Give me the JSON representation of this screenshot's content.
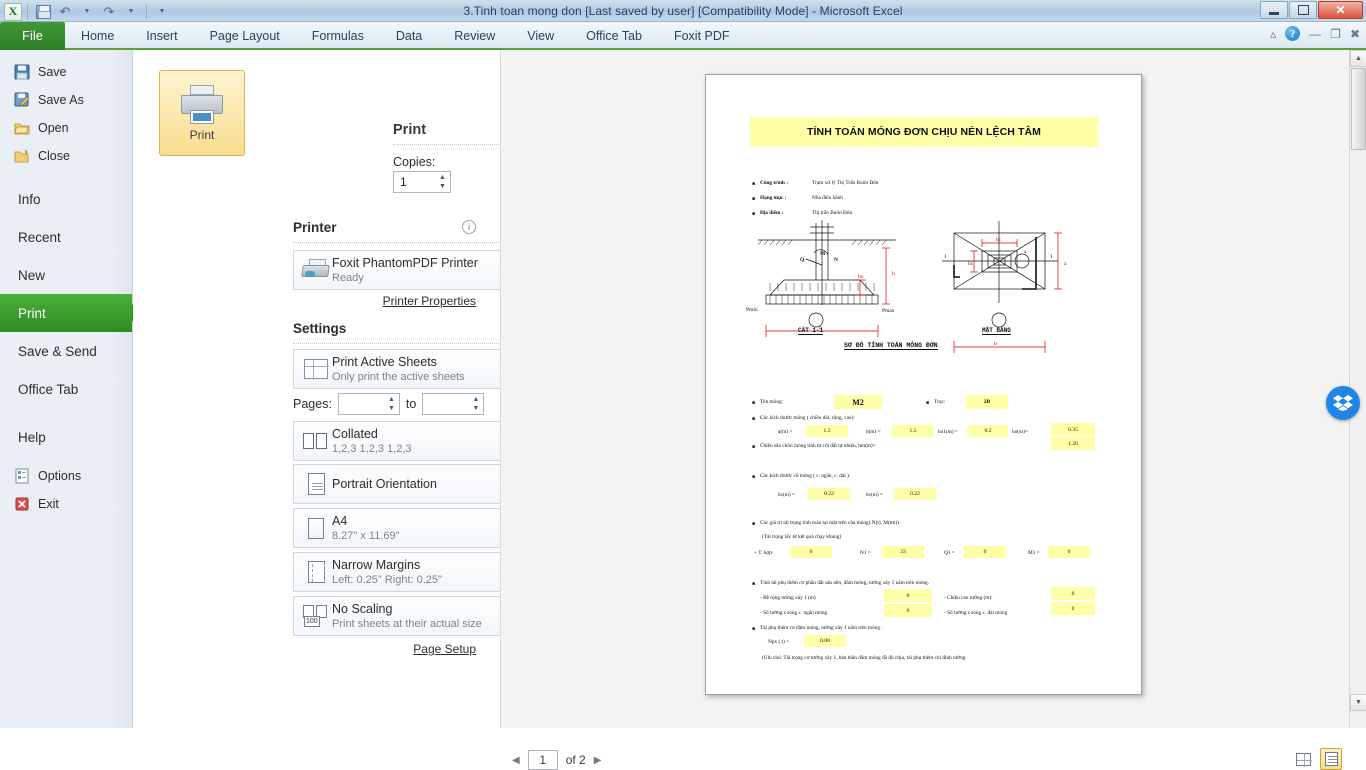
{
  "window": {
    "title": "3.Tinh toan mong don [Last saved by user]  [Compatibility Mode]  -  Microsoft Excel",
    "quick_access": [
      {
        "name": "excel-logo",
        "label": "X"
      },
      {
        "name": "save",
        "label": ""
      },
      {
        "name": "undo",
        "label": "↶"
      },
      {
        "name": "redo",
        "label": "↷"
      },
      {
        "name": "customize-qat",
        "label": "▾"
      }
    ],
    "controls": {
      "minimize": "–",
      "restore": "❐",
      "close": "✕"
    },
    "ribbon_right": {
      "collapse": "⌃",
      "help": "?",
      "win_min": "–",
      "win_restore": "❐",
      "win_close": "✕"
    }
  },
  "ribbon": {
    "tabs": [
      {
        "label": "File",
        "active": true
      },
      {
        "label": "Home",
        "active": false
      },
      {
        "label": "Insert",
        "active": false
      },
      {
        "label": "Page Layout",
        "active": false
      },
      {
        "label": "Formulas",
        "active": false
      },
      {
        "label": "Data",
        "active": false
      },
      {
        "label": "Review",
        "active": false
      },
      {
        "label": "View",
        "active": false
      },
      {
        "label": "Office Tab",
        "active": false
      },
      {
        "label": "Foxit PDF",
        "active": false
      }
    ]
  },
  "sidebar": {
    "items": [
      {
        "label": "Save",
        "icon": "floppy-disk-icon",
        "type": "icon",
        "selected": false
      },
      {
        "label": "Save As",
        "icon": "save-as-icon",
        "type": "icon",
        "selected": false
      },
      {
        "label": "Open",
        "icon": "open-folder-icon",
        "type": "icon",
        "selected": false
      },
      {
        "label": "Close",
        "icon": "close-folder-icon",
        "type": "icon",
        "selected": false
      },
      {
        "label": "Info",
        "icon": "",
        "type": "big",
        "selected": false
      },
      {
        "label": "Recent",
        "icon": "",
        "type": "big",
        "selected": false
      },
      {
        "label": "New",
        "icon": "",
        "type": "big",
        "selected": false
      },
      {
        "label": "Print",
        "icon": "",
        "type": "big",
        "selected": true
      },
      {
        "label": "Save & Send",
        "icon": "",
        "type": "big",
        "selected": false
      },
      {
        "label": "Office Tab",
        "icon": "",
        "type": "big",
        "selected": false
      },
      {
        "label": "Help",
        "icon": "",
        "type": "big",
        "selected": false
      },
      {
        "label": "Options",
        "icon": "options-icon",
        "type": "icon",
        "selected": false
      },
      {
        "label": "Exit",
        "icon": "exit-icon",
        "type": "icon",
        "selected": false
      }
    ]
  },
  "print": {
    "button_label": "Print",
    "heading": "Print",
    "copies_label": "Copies:",
    "copies_value": "1",
    "printer_section": "Printer",
    "printer_name": "Foxit PhantomPDF Printer",
    "printer_status": "Ready",
    "printer_properties_link": "Printer Properties",
    "settings_section": "Settings",
    "settings": [
      {
        "name": "print-what",
        "title": "Print Active Sheets",
        "subtitle": "Only print the active sheets",
        "icon": "sheets-icon"
      },
      {
        "name": "collation",
        "title": "Collated",
        "subtitle": "1,2,3   1,2,3   1,2,3",
        "icon": "collate-icon"
      },
      {
        "name": "orientation",
        "title": "Portrait Orientation",
        "subtitle": "",
        "icon": "portrait-icon"
      },
      {
        "name": "paper-size",
        "title": "A4",
        "subtitle": "8.27\" x 11.69\"",
        "icon": "paper-icon"
      },
      {
        "name": "margins",
        "title": "Narrow Margins",
        "subtitle": "Left:  0.25\"    Right:  0.25\"",
        "icon": "margins-icon"
      },
      {
        "name": "scaling",
        "title": "No Scaling",
        "subtitle": "Print sheets at their actual size",
        "icon": "scaling-icon"
      }
    ],
    "pages_label": "Pages:",
    "pages_from": "",
    "pages_to_label": "to",
    "pages_to": "",
    "page_setup_link": "Page Setup"
  },
  "preview": {
    "current_page": "1",
    "page_count_label": "of 2",
    "prev_arrow": "◀",
    "next_arrow": "▶",
    "show_margins_tooltip": "Show Margins",
    "zoom_to_page_tooltip": "Zoom to Page"
  },
  "document": {
    "title": "TÍNH TOÁN MÓNG ĐƠN CHỊU NÉN LỆCH TÂM",
    "header_rows": [
      {
        "label": "Công trình :",
        "value": "Trạm xử lý Thị Trấn Buôn Đôn"
      },
      {
        "label": "Hạng mục :",
        "value": "Nhà điều hành"
      },
      {
        "label": "Địa điểm :",
        "value": "Thị trấn Buôn Đôn"
      }
    ],
    "diagram": {
      "section_caption": "CẮT 1-1",
      "plan_caption": "MẬT BẰNG",
      "main_caption": "SƠ ĐỒ TÍNH TOÁN MÓNG ĐƠN",
      "labels": [
        "M",
        "N",
        "Q",
        "Pmin",
        "Pmax",
        "b",
        "a",
        "h",
        "ho",
        "1",
        "1"
      ]
    },
    "fields": {
      "name_label": "Tên móng:",
      "name_value": "M2",
      "axis_label": "Trục:",
      "axis_value": "2B",
      "dims_note": "Các kích thước móng ( chiều dài, rộng, cao):",
      "a_label": "a(m) =",
      "a_value": "1.5",
      "b_label": "b(m) =",
      "b_value": "1.5",
      "ho1_label": "ho1(m) =",
      "ho1_value": "0.2",
      "ho_label": "ho(m)=",
      "ho_value": "0.35",
      "depth_label": "Chiều sâu chôn móng tính từ cốt đất tự nhiên, hm(m)=",
      "depth_value": "1.20",
      "col_note": "Các kích thước cổ móng ( c. ngắn, c. dài ):",
      "hc_label": "hc(m) =",
      "hc_value": "0.22",
      "bc_label": "bc(m) =",
      "bc_value": "0.22",
      "load_note": "Các giá trị tải trọng tính toán tại mặt trên của móng( N(t), M(tm))",
      "load_subnote": "(Tải trọng lấy từ kết quả chạy khung)",
      "case_label": "+ T. hợp:",
      "case_value": "6",
      "n1_label": "N1 =",
      "n1_value": "33",
      "q1_label": "Q1 =",
      "q1_value": "0",
      "m1_label": "M1 =",
      "m1_value": "0",
      "extra_note": "Tính tải phụ thêm cơ phần đất sân nền, dầm móng, tường xây 1 năm trên móng.",
      "wall_width_label": "- Bề rộng tường xây 1 (m)",
      "wall_width_value": "0",
      "wall_height_label": "- Chiều cao tường (m):",
      "wall_height_value": "0",
      "count_short_label": "- Số tường s song  c. ngắn móng",
      "count_short_value": "0",
      "count_long_label": "- Số tường s song  c. dài móng",
      "count_long_value": "0",
      "extra2_note": "Tải phụ thêm cơ dầm móng, tường xây 1 năm trên móng .",
      "npx_label": "Npx ( t) =",
      "npx_value": "0.00",
      "footnote": "(Ghi chú: Tải trọng cơ tường xây 1, bản thân dầm móng đã đủ chịu, tải phụ thêm chỉ định tường"
    }
  },
  "colors": {
    "accent_green": "#2f8b22",
    "highlight_yellow": "#ffffa8",
    "title_bar": "#b9cfe4",
    "diagram_red": "#e00000"
  }
}
